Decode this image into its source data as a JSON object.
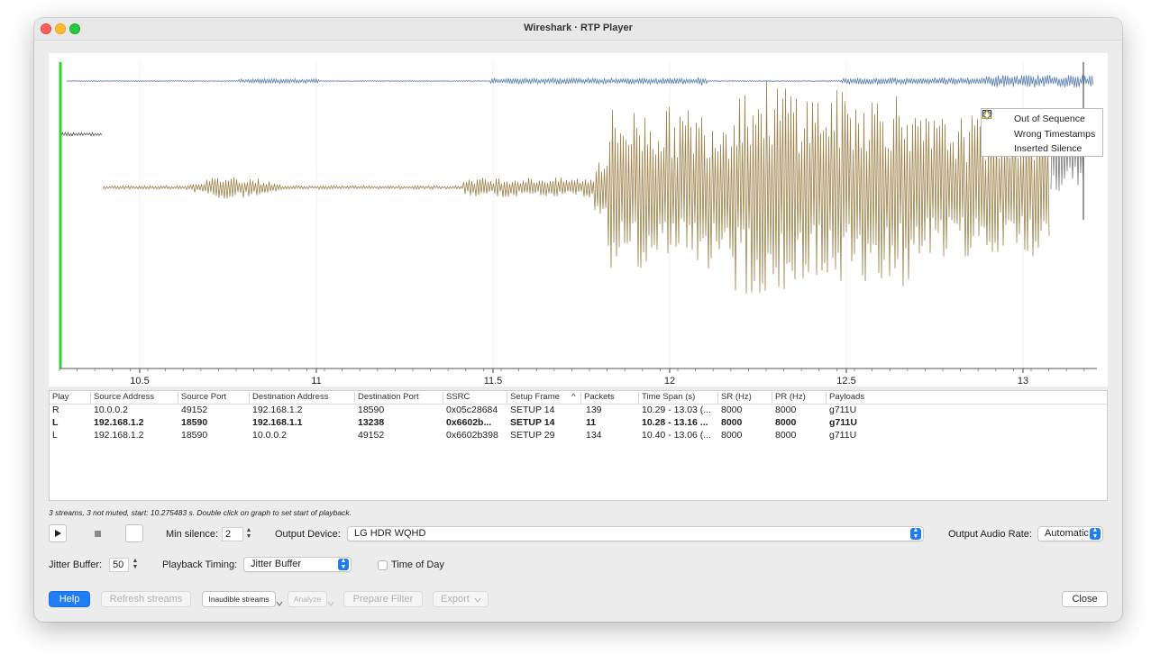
{
  "window": {
    "title": "Wireshark · RTP Player"
  },
  "graph": {
    "x_ticks": [
      "10.5",
      "11",
      "11.5",
      "12",
      "12.5",
      "13"
    ],
    "legend": [
      {
        "label": "Out of Sequence",
        "icon": "square-icon"
      },
      {
        "label": "Wrong Timestamps",
        "icon": "diamond-icon"
      },
      {
        "label": "Inserted Silence",
        "icon": "triangle-icon"
      }
    ],
    "colors": {
      "stream_r": "#5b7fb3",
      "stream_l1": "#5a5a5a",
      "stream_l2": "#9c8149",
      "playhead": "#2bd62b"
    }
  },
  "table": {
    "columns": [
      "Play",
      "Source Address",
      "Source Port",
      "Destination Address",
      "Destination Port",
      "SSRC",
      "Setup Frame",
      "^",
      "Packets",
      "Time Span (s)",
      "SR (Hz)",
      "PR (Hz)",
      "Payloads"
    ],
    "rows": [
      {
        "play": "R",
        "src_addr": "10.0.0.2",
        "src_port": "49152",
        "dst_addr": "192.168.1.2",
        "dst_port": "18590",
        "ssrc": "0x05c28684",
        "setup": "SETUP 14",
        "packets": "139",
        "span": "10.29 - 13.03 (...",
        "sr": "8000",
        "pr": "8000",
        "payload": "g711U"
      },
      {
        "play": "L",
        "src_addr": "192.168.1.2",
        "src_port": "18590",
        "dst_addr": "192.168.1.1",
        "dst_port": "13238",
        "ssrc": "0x6602b...",
        "setup": "SETUP 14",
        "packets": "11",
        "span": "10.28 - 13.16 ...",
        "sr": "8000",
        "pr": "8000",
        "payload": "g711U"
      },
      {
        "play": "L",
        "src_addr": "192.168.1.2",
        "src_port": "18590",
        "dst_addr": "10.0.0.2",
        "dst_port": "49152",
        "ssrc": "0x6602b398",
        "setup": "SETUP 29",
        "packets": "134",
        "span": "10.40 - 13.06 (...",
        "sr": "8000",
        "pr": "8000",
        "payload": "g711U"
      }
    ]
  },
  "status": "3 streams, 3 not muted, start: 10.275483 s. Double click on graph to set start of playback.",
  "controls": {
    "min_silence_label": "Min silence:",
    "min_silence_value": "2",
    "output_device_label": "Output Device:",
    "output_device_value": "LG HDR WQHD",
    "output_rate_label": "Output Audio Rate:",
    "output_rate_value": "Automatic",
    "jitter_label": "Jitter Buffer:",
    "jitter_value": "50",
    "timing_label": "Playback Timing:",
    "timing_value": "Jitter Buffer",
    "time_of_day_label": "Time of Day"
  },
  "buttons": {
    "help": "Help",
    "refresh": "Refresh streams",
    "inaudible": "Inaudible streams",
    "analyze": "Analyze",
    "prepare_filter": "Prepare Filter",
    "export": "Export",
    "close": "Close"
  }
}
